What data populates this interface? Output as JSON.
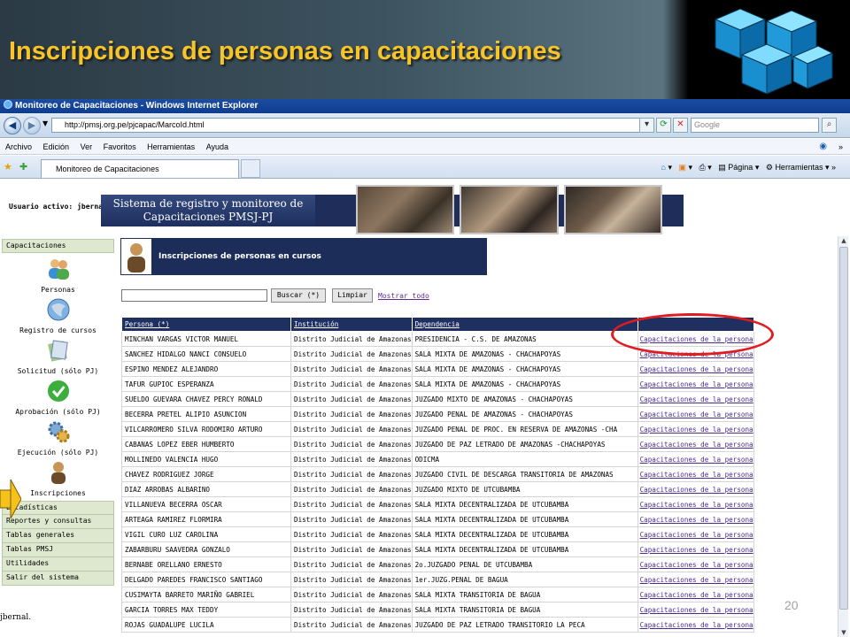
{
  "slide": {
    "title": "Inscripciones de personas en capacitaciones",
    "page_number": "20"
  },
  "browser": {
    "window_title": "Monitoreo de Capacitaciones - Windows Internet Explorer",
    "address": "http://pmsj.org.pe/pjcapac/MarcoId.html",
    "search_placeholder": "Google",
    "menu": [
      "Archivo",
      "Edición",
      "Ver",
      "Favoritos",
      "Herramientas",
      "Ayuda"
    ],
    "tab_label": "Monitoreo de Capacitaciones",
    "command_page": "Página",
    "command_tools": "Herramientas"
  },
  "app": {
    "user_label": "Usuario activo:",
    "user_name": "jbernal",
    "banner_line1": "Sistema de registro y monitoreo de",
    "banner_line2": "Capacitaciones PMSJ-PJ",
    "footer_user": "jbernal."
  },
  "sidebar": {
    "header": "Capacitaciones",
    "items": [
      {
        "label": "Personas",
        "icon": "people-icon"
      },
      {
        "label": "Registro de cursos",
        "icon": "globe-icon"
      },
      {
        "label": "Solicitud (sólo PJ)",
        "icon": "document-icon"
      },
      {
        "label": "Aprobación (sólo PJ)",
        "icon": "checkmark-icon"
      },
      {
        "label": "Ejecución (sólo PJ)",
        "icon": "gears-icon"
      },
      {
        "label": "Inscripciones",
        "icon": "person-icon"
      }
    ],
    "menus": [
      "Estadísticas",
      "Reportes y consultas",
      "Tablas generales",
      "Tablas PMSJ",
      "Utilidades",
      "Salir del sistema"
    ]
  },
  "main": {
    "panel_title": "Inscripciones de personas en cursos",
    "search_button": "Buscar (*)",
    "clear_button": "Limpiar",
    "show_all": "Mostrar todo",
    "columns": [
      "Persona (*)",
      "Institución",
      "Dependencia"
    ],
    "link_text": "Capacitaciones de la persona",
    "rows": [
      [
        "MINCHAN VARGAS VICTOR MANUEL",
        "Distrito Judicial de Amazonas",
        "PRESIDENCIA - C.S. DE AMAZONAS"
      ],
      [
        "SANCHEZ HIDALGO NANCI CONSUELO",
        "Distrito Judicial de Amazonas",
        "SALA MIXTA DE AMAZONAS - CHACHAPOYAS"
      ],
      [
        "ESPINO MENDEZ ALEJANDRO",
        "Distrito Judicial de Amazonas",
        "SALA MIXTA DE AMAZONAS - CHACHAPOYAS"
      ],
      [
        "TAFUR GUPIOC ESPERANZA",
        "Distrito Judicial de Amazonas",
        "SALA MIXTA DE AMAZONAS - CHACHAPOYAS"
      ],
      [
        "SUELDO GUEVARA CHAVEZ PERCY RONALD",
        "Distrito Judicial de Amazonas",
        "JUZGADO MIXTO DE AMAZONAS - CHACHAPOYAS"
      ],
      [
        "BECERRA PRETEL ALIPIO ASUNCION",
        "Distrito Judicial de Amazonas",
        "JUZGADO PENAL DE AMAZONAS - CHACHAPOYAS"
      ],
      [
        "VILCARROMERO SILVA RODOMIRO ARTURO",
        "Distrito Judicial de Amazonas",
        "JUZGADO PENAL DE PROC. EN RESERVA DE AMAZONAS -CHA"
      ],
      [
        "CABANAS LOPEZ EBER HUMBERTO",
        "Distrito Judicial de Amazonas",
        "JUZGADO DE PAZ LETRADO DE AMAZONAS -CHACHAPOYAS"
      ],
      [
        "MOLLINEDO VALENCIA HUGO",
        "Distrito Judicial de Amazonas",
        "ODICMA"
      ],
      [
        "CHAVEZ RODRIGUEZ JORGE",
        "Distrito Judicial de Amazonas",
        "JUZGADO CIVIL DE DESCARGA TRANSITORIA DE AMAZONAS"
      ],
      [
        "DIAZ ARROBAS ALBARINO",
        "Distrito Judicial de Amazonas",
        "JUZGADO MIXTO DE UTCUBAMBA"
      ],
      [
        "VILLANUEVA BECERRA OSCAR",
        "Distrito Judicial de Amazonas",
        "SALA MIXTA DECENTRALIZADA DE UTCUBAMBA"
      ],
      [
        "ARTEAGA RAMIREZ FLORMIRA",
        "Distrito Judicial de Amazonas",
        "SALA MIXTA DECENTRALIZADA DE UTCUBAMBA"
      ],
      [
        "VIGIL CURO LUZ CAROLINA",
        "Distrito Judicial de Amazonas",
        "SALA MIXTA DECENTRALIZADA DE UTCUBAMBA"
      ],
      [
        "ZABARBURU SAAVEDRA GONZALO",
        "Distrito Judicial de Amazonas",
        "SALA MIXTA DECENTRALIZADA DE UTCUBAMBA"
      ],
      [
        "BERNABE ORELLANO ERNESTO",
        "Distrito Judicial de Amazonas",
        "2o.JUZGADO PENAL DE UTCUBAMBA"
      ],
      [
        "DELGADO PAREDES FRANCISCO SANTIAGO",
        "Distrito Judicial de Amazonas",
        "1er.JUZG.PENAL DE BAGUA"
      ],
      [
        "CUSIMAYTA BARRETO MARIÑO GABRIEL",
        "Distrito Judicial de Amazonas",
        "SALA MIXTA TRANSITORIA DE BAGUA"
      ],
      [
        "GARCIA TORRES MAX TEDDY",
        "Distrito Judicial de Amazonas",
        "SALA MIXTA TRANSITORIA DE BAGUA"
      ],
      [
        "ROJAS GUADALUPE LUCILA",
        "Distrito Judicial de Amazonas",
        "JUZGADO DE PAZ LETRADO TRANSITORIO LA PECA"
      ]
    ]
  },
  "colors": {
    "title_gold": "#f7c528",
    "header_navy": "#1f2f60",
    "highlight_red": "#e11b22",
    "sidebar_green": "#dde8ce"
  }
}
